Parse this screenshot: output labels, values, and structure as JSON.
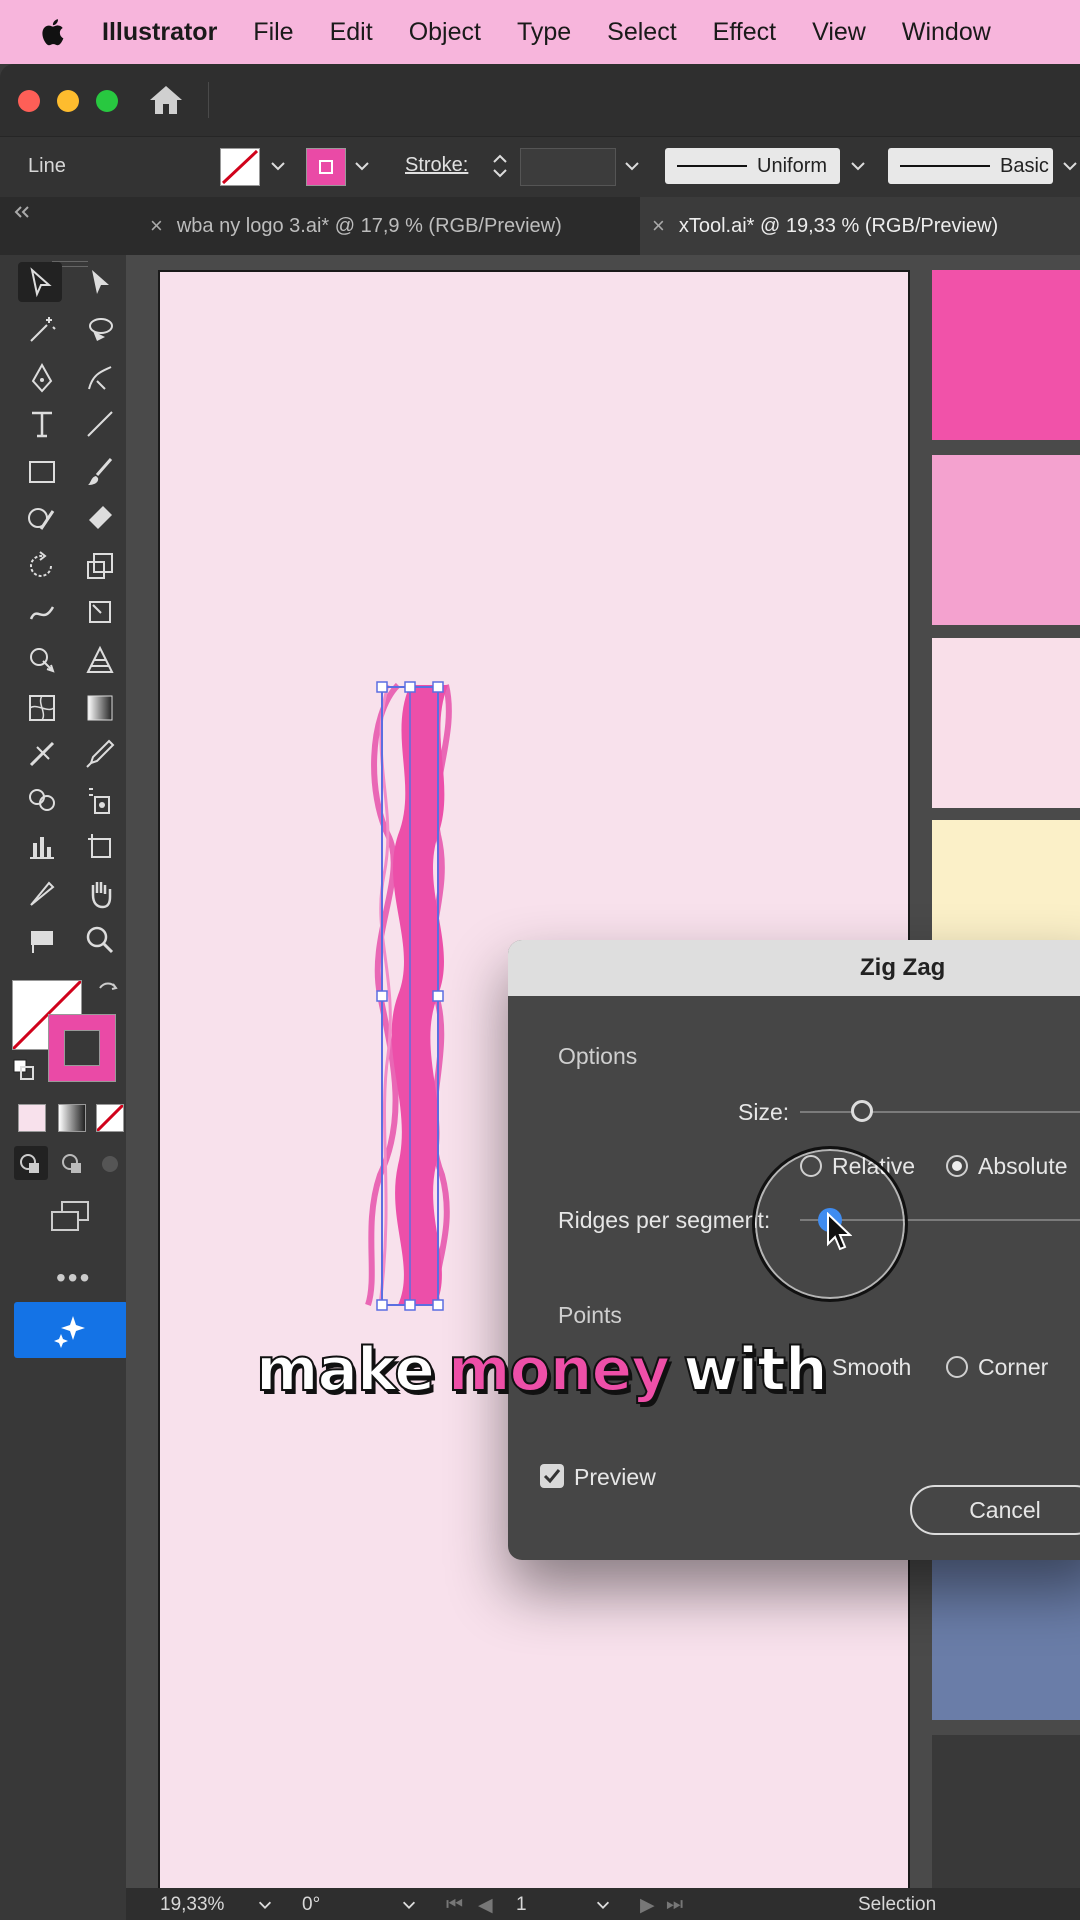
{
  "menubar": {
    "app": "Illustrator",
    "items": [
      "File",
      "Edit",
      "Object",
      "Type",
      "Select",
      "Effect",
      "View",
      "Window"
    ]
  },
  "control_bar": {
    "selection_type": "Line",
    "stroke_label": "Stroke:",
    "variable_width_profile": "Uniform",
    "brush": "Basic"
  },
  "tabs": [
    {
      "label": "wba ny logo 3.ai* @ 17,9 % (RGB/Preview)",
      "active": false
    },
    {
      "label": "xTool.ai* @ 19,33 % (RGB/Preview)",
      "active": true
    }
  ],
  "colors": {
    "menubar": "#f7b5dc",
    "accent_pink": "#ea4aa6",
    "artboard": "#f8e1ec",
    "selection_blue": "#5b6ee1",
    "ai_button": "#1473e6"
  },
  "swatches": [
    "#f152a9",
    "#f4a2cf",
    "#f9dfe9",
    "#fbf0c8",
    "#6a7da8",
    "#393939"
  ],
  "dialog": {
    "title": "Zig Zag",
    "options_label": "Options",
    "size_label": "Size:",
    "relative_label": "Relative",
    "absolute_label": "Absolute",
    "absolute_selected": true,
    "ridges_label": "Ridges per segment:",
    "points_label": "Points",
    "smooth_label": "Smooth",
    "corner_label": "Corner",
    "preview_label": "Preview",
    "preview_checked": true,
    "cancel_label": "Cancel"
  },
  "caption": {
    "words": [
      "make",
      "money",
      "with"
    ],
    "highlight": "money"
  },
  "statusbar": {
    "zoom": "19,33%",
    "rotation": "0°",
    "artboard": "1",
    "tool": "Selection"
  }
}
